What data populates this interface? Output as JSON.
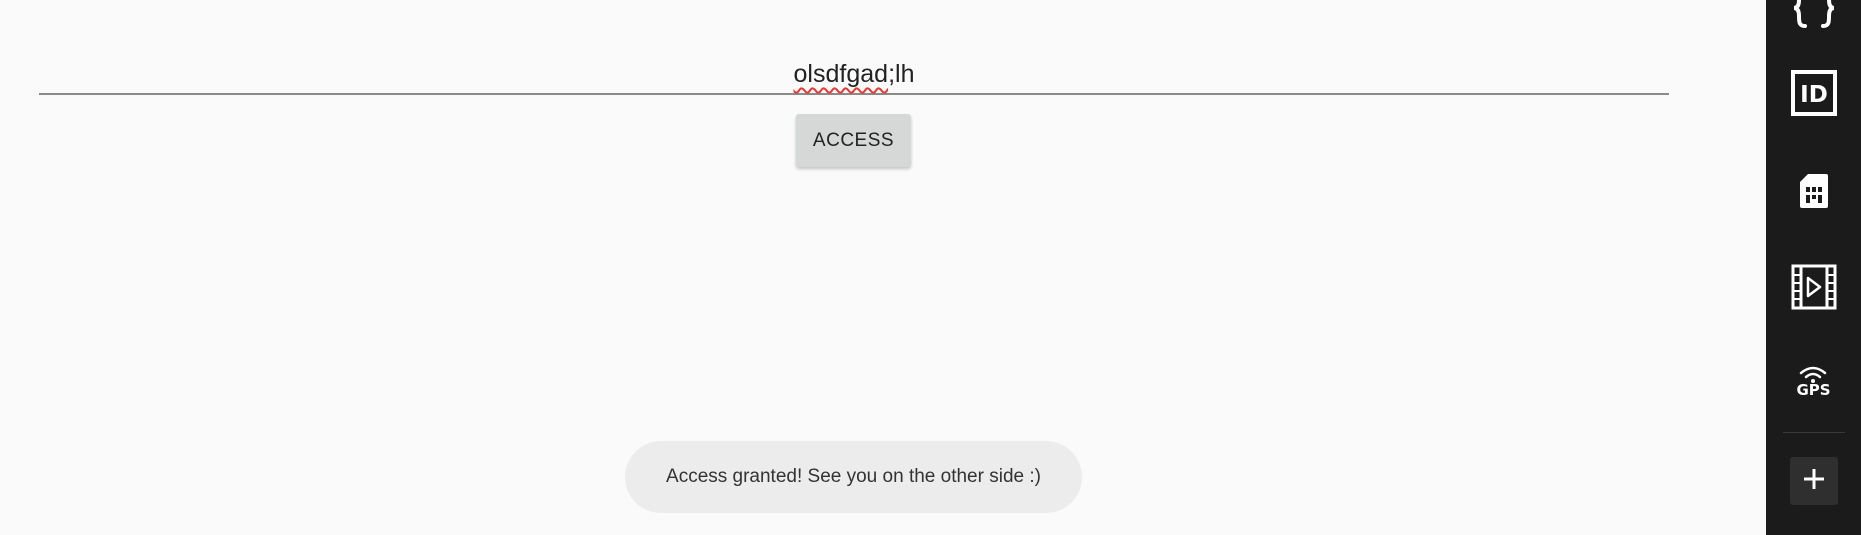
{
  "input": {
    "value_misspelled": "olsdfgad",
    "value_rest": ";lh"
  },
  "button": {
    "label": "ACCESS"
  },
  "toast": {
    "message": "Access granted! See you on the other side :)"
  },
  "sidebar": {
    "items": [
      {
        "icon": "braces-icon"
      },
      {
        "icon": "id-card-icon",
        "text": "ID"
      },
      {
        "icon": "sim-card-icon"
      },
      {
        "icon": "video-film-icon"
      },
      {
        "icon": "gps-icon",
        "text": "GPS"
      },
      {
        "icon": "plus-icon"
      }
    ]
  },
  "colors": {
    "background": "#fafafa",
    "sidebar": "#1b1b1b",
    "button": "#d6d7d7",
    "toast": "#ececec",
    "spell_underline": "#e53935"
  }
}
